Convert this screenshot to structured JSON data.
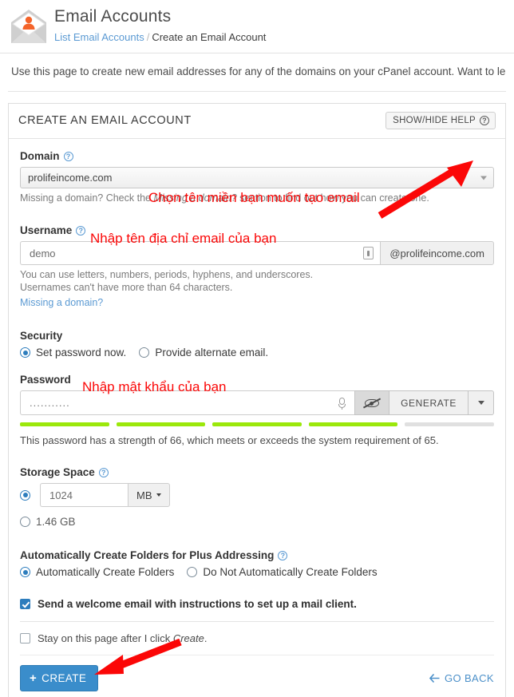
{
  "header": {
    "title": "Email Accounts",
    "icon": "email-account-icon",
    "breadcrumb": {
      "link": "List Email Accounts",
      "separator": "/",
      "current": "Create an Email Account"
    }
  },
  "intro": {
    "text": "Use this page to create new email addresses for any of the domains on your cPanel account. Want to learn m"
  },
  "panel": {
    "title": "CREATE AN EMAIL ACCOUNT",
    "help_button": "SHOW/HIDE HELP",
    "help_icon": "question-mark-icon"
  },
  "domain": {
    "label": "Domain",
    "selected": "prolifeincome.com",
    "hint_before": "Missing a domain? Check the ",
    "hint_italic": "Missing a domain?",
    "hint_after": " section to find out how you can create one."
  },
  "username": {
    "label": "Username",
    "value": "demo",
    "suffix": "@prolifeincome.com",
    "hint1": "You can use letters, numbers, periods, hyphens, and underscores.",
    "hint2": "Usernames can't have more than 64 characters.",
    "link": "Missing a domain?"
  },
  "security": {
    "label": "Security",
    "options": [
      {
        "label": "Set password now.",
        "selected": true
      },
      {
        "label": "Provide alternate email.",
        "selected": false
      }
    ]
  },
  "password": {
    "label": "Password",
    "value": "...........",
    "mic_icon": "microphone-icon",
    "toggle_icon": "eye-slash-icon",
    "generate_label": "GENERATE",
    "caret_icon": "chevron-down-icon",
    "strength_segments": [
      true,
      true,
      true,
      true,
      false
    ],
    "strength_color": "#9be80b",
    "strength_empty_color": "#e0e0e0",
    "strength_text": "This password has a strength of 66, which meets or exceeds the system requirement of 65.",
    "strength_value": 66,
    "strength_required": 65
  },
  "storage": {
    "label": "Storage Space",
    "quota_value": "1024",
    "unit": "MB",
    "unit_caret": "chevron-down-icon",
    "quota_selected": true,
    "unlimited_label": "1.46 GB",
    "unlimited_selected": false
  },
  "plus_addressing": {
    "label": "Automatically Create Folders for Plus Addressing",
    "options": [
      {
        "label": "Automatically Create Folders",
        "selected": true
      },
      {
        "label": "Do Not Automatically Create Folders",
        "selected": false
      }
    ]
  },
  "welcome": {
    "label": "Send a welcome email with instructions to set up a mail client.",
    "checked": true
  },
  "footer": {
    "stay_before": "Stay on this page after I click ",
    "stay_italic": "Create",
    "stay_after": ".",
    "stay_checked": false,
    "create_label": "CREATE",
    "create_plus": "+",
    "go_back_label": "GO BACK",
    "go_back_icon": "arrow-left-icon",
    "create_color": "#3a8dcb"
  },
  "annotations": {
    "color": "#fb0707",
    "domain_note": "Chọn tên miền bạn muốn tạo email",
    "username_note": "Nhập tên địa chỉ email của bạn",
    "password_note": "Nhập mật khẩu của bạn",
    "arrow_domain": "arrow-up-right-icon",
    "arrow_create": "arrow-left-icon"
  }
}
